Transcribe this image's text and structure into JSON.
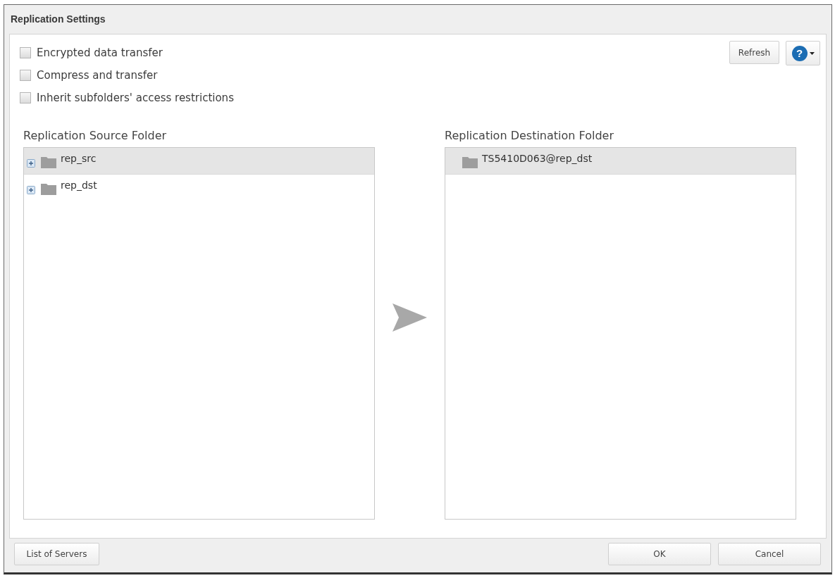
{
  "window": {
    "title": "Replication Settings"
  },
  "options": [
    {
      "label": "Encrypted data transfer",
      "checked": false
    },
    {
      "label": "Compress and transfer",
      "checked": false
    },
    {
      "label": "Inherit subfolders' access restrictions",
      "checked": false
    }
  ],
  "toolbar": {
    "refresh": "Refresh",
    "help": "?"
  },
  "source": {
    "label": "Replication Source Folder",
    "items": [
      {
        "name": "rep_src",
        "expandable": true,
        "selected": true
      },
      {
        "name": "rep_dst",
        "expandable": true,
        "selected": false
      }
    ]
  },
  "destination": {
    "label": "Replication Destination Folder",
    "items": [
      {
        "name": "TS5410D063@rep_dst",
        "expandable": false,
        "selected": true
      }
    ]
  },
  "footer": {
    "list_servers": "List of Servers",
    "ok": "OK",
    "cancel": "Cancel"
  }
}
